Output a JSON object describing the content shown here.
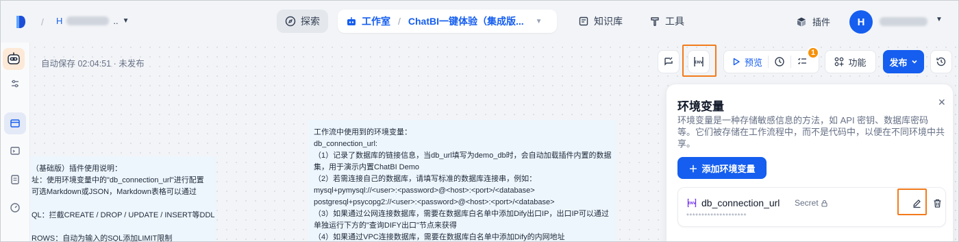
{
  "topnav": {
    "workspace_initial": "H",
    "workspace_suffix": "..",
    "explore_label": "探索",
    "studio_label": "工作室",
    "app_name": "ChatBI一键体验（集成版...",
    "knowledge_label": "知识库",
    "tools_label": "工具",
    "plugins_label": "插件",
    "avatar_initial": "H"
  },
  "canvas": {
    "autosave_text": "自动保存 02:04:51 · 未发布",
    "note_left_text": "（基础版）插件使用说明：\n址：使用环境变量中的\"db_connection_url\"进行配置\n可选Markdown或JSON，Markdown表格可以通过\n\nQL：拦截CREATE / DROP / UPDATE / INSERT等DDL\n\nROWS：自动为输入的SQL添加LIMIT限制",
    "note_right_text": "工作流中使用到的环境变量：\ndb_connection_url:\n（1）记录了数据库的链接信息，当db_url填写为demo_db时，会自动加载插件内置的数据\n集，用于演示内置ChatBI Demo\n（2）若需连接自己的数据库，请填写标准的数据库连接串，例如：\nmysql+pymysql://<user>:<password>@<host>:<port>/<database>\npostgresql+psycopg2://<user>:<password>@<host>:<port>/<database>\n（3）如果通过公网连接数据库，需要在数据库白名单中添加Dify出口IP，出口IP可以通过\n单独运行下方的\"查询DIFY出口\"节点来获得\n（4）如果通过VPC连接数据库，需要在数据库白名单中添加Dify的内网地址"
  },
  "toolbar": {
    "preview_label": "预览",
    "badge_count": "1",
    "features_label": "功能",
    "publish_label": "发布"
  },
  "env_panel": {
    "title": "环境变量",
    "description": "环境变量是一种存储敏感信息的方法，如 API 密钥、数据库密码等。它们被存储在工作流程中，而不是代码中，以便在不同环境中共享。",
    "add_button_label": "添加环境变量",
    "variables": [
      {
        "name": "db_connection_url",
        "type": "Secret",
        "value": "********************"
      }
    ]
  },
  "colors": {
    "accent": "#155eef",
    "highlight": "#f27b1b",
    "badge": "#f79009"
  }
}
